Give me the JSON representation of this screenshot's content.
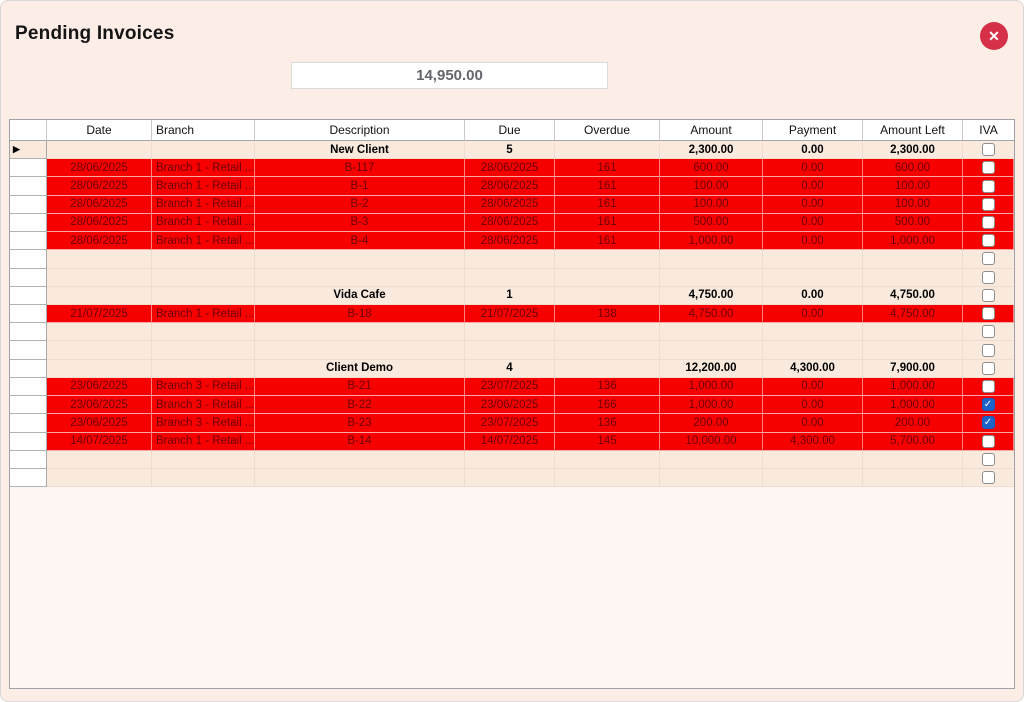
{
  "window": {
    "title": "Pending Invoices"
  },
  "close_button": {
    "icon": "close",
    "color": "#d63049",
    "glyph": "✕"
  },
  "total_box": {
    "value": "14,950.00"
  },
  "grid": {
    "columns": [
      {
        "key": "rowhdr",
        "label": ""
      },
      {
        "key": "date",
        "label": "Date"
      },
      {
        "key": "branch",
        "label": "Branch"
      },
      {
        "key": "description",
        "label": "Description"
      },
      {
        "key": "due",
        "label": "Due"
      },
      {
        "key": "overdue",
        "label": "Overdue"
      },
      {
        "key": "amount",
        "label": "Amount"
      },
      {
        "key": "payment",
        "label": "Payment"
      },
      {
        "key": "amount_left",
        "label": "Amount Left"
      },
      {
        "key": "iva",
        "label": "IVA"
      }
    ],
    "colors": {
      "invoice_row": "#f60000",
      "invoice_text": "#6e0000",
      "group_row": "#faeadd",
      "checkbox_checked": "#1e64c8"
    },
    "rows": [
      {
        "type": "group",
        "current": true,
        "date": "",
        "branch": "",
        "description": "New Client",
        "due": "5",
        "overdue": "",
        "amount": "2,300.00",
        "payment": "0.00",
        "amount_left": "2,300.00",
        "iva": {
          "present": true,
          "checked": false
        }
      },
      {
        "type": "invoice",
        "date": "28/06/2025",
        "branch": "Branch 1 - Retail ...",
        "description": "B-117",
        "due": "28/06/2025",
        "overdue": "161",
        "amount": "600.00",
        "payment": "0.00",
        "amount_left": "600.00",
        "iva": {
          "present": true,
          "checked": false
        }
      },
      {
        "type": "invoice",
        "date": "28/06/2025",
        "branch": "Branch 1 - Retail ...",
        "description": "B-1",
        "due": "28/06/2025",
        "overdue": "161",
        "amount": "100.00",
        "payment": "0.00",
        "amount_left": "100.00",
        "iva": {
          "present": true,
          "checked": false
        }
      },
      {
        "type": "invoice",
        "date": "28/06/2025",
        "branch": "Branch 1 - Retail ...",
        "description": "B-2",
        "due": "28/06/2025",
        "overdue": "161",
        "amount": "100.00",
        "payment": "0.00",
        "amount_left": "100.00",
        "iva": {
          "present": true,
          "checked": false
        }
      },
      {
        "type": "invoice",
        "date": "28/06/2025",
        "branch": "Branch 1 - Retail ...",
        "description": "B-3",
        "due": "28/06/2025",
        "overdue": "161",
        "amount": "500.00",
        "payment": "0.00",
        "amount_left": "500.00",
        "iva": {
          "present": true,
          "checked": false
        }
      },
      {
        "type": "invoice",
        "date": "28/06/2025",
        "branch": "Branch 1 - Retail ...",
        "description": "B-4",
        "due": "28/06/2025",
        "overdue": "161",
        "amount": "1,000.00",
        "payment": "0.00",
        "amount_left": "1,000.00",
        "iva": {
          "present": true,
          "checked": false
        }
      },
      {
        "type": "empty",
        "iva": {
          "present": true,
          "checked": false
        }
      },
      {
        "type": "empty",
        "iva": {
          "present": true,
          "checked": false
        }
      },
      {
        "type": "group",
        "date": "",
        "branch": "",
        "description": "Vida Cafe",
        "due": "1",
        "overdue": "",
        "amount": "4,750.00",
        "payment": "0.00",
        "amount_left": "4,750.00",
        "iva": {
          "present": true,
          "checked": false
        }
      },
      {
        "type": "invoice",
        "date": "21/07/2025",
        "branch": "Branch 1 - Retail ...",
        "description": "B-18",
        "due": "21/07/2025",
        "overdue": "138",
        "amount": "4,750.00",
        "payment": "0.00",
        "amount_left": "4,750.00",
        "iva": {
          "present": true,
          "checked": false
        }
      },
      {
        "type": "empty",
        "iva": {
          "present": true,
          "checked": false
        }
      },
      {
        "type": "empty",
        "iva": {
          "present": true,
          "checked": false
        }
      },
      {
        "type": "group",
        "date": "",
        "branch": "",
        "description": "Client Demo",
        "due": "4",
        "overdue": "",
        "amount": "12,200.00",
        "payment": "4,300.00",
        "amount_left": "7,900.00",
        "iva": {
          "present": true,
          "checked": false
        }
      },
      {
        "type": "invoice",
        "date": "23/06/2025",
        "branch": "Branch 3 - Retail ...",
        "description": "B-21",
        "due": "23/07/2025",
        "overdue": "136",
        "amount": "1,000.00",
        "payment": "0.00",
        "amount_left": "1,000.00",
        "iva": {
          "present": true,
          "checked": false
        }
      },
      {
        "type": "invoice",
        "date": "23/06/2025",
        "branch": "Branch 3 - Retail ...",
        "description": "B-22",
        "due": "23/06/2025",
        "overdue": "166",
        "amount": "1,000.00",
        "payment": "0.00",
        "amount_left": "1,000.00",
        "iva": {
          "present": true,
          "checked": true
        }
      },
      {
        "type": "invoice",
        "date": "23/06/2025",
        "branch": "Branch 3 - Retail ...",
        "description": "B-23",
        "due": "23/07/2025",
        "overdue": "136",
        "amount": "200.00",
        "payment": "0.00",
        "amount_left": "200.00",
        "iva": {
          "present": true,
          "checked": true
        }
      },
      {
        "type": "invoice",
        "date": "14/07/2025",
        "branch": "Branch 1 - Retail ...",
        "description": "B-14",
        "due": "14/07/2025",
        "overdue": "145",
        "amount": "10,000.00",
        "payment": "4,300.00",
        "amount_left": "5,700.00",
        "iva": {
          "present": true,
          "checked": false
        }
      },
      {
        "type": "empty",
        "iva": {
          "present": true,
          "checked": false
        }
      },
      {
        "type": "empty",
        "iva": {
          "present": true,
          "checked": false
        }
      }
    ]
  }
}
